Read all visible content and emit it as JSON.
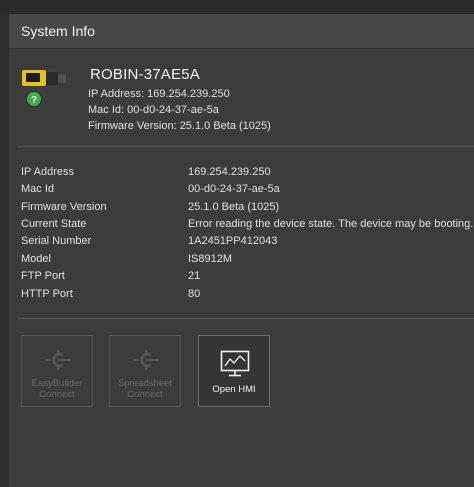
{
  "panel": {
    "title": "System Info"
  },
  "device": {
    "name": "ROBIN-37AE5A",
    "ip_line": "IP Address: 169.254.239.250",
    "mac_line": "Mac Id: 00-d0-24-37-ae-5a",
    "fw_line": "Firmware Version: 25.1.0 Beta (1025)",
    "status_badge": "?"
  },
  "info": {
    "rows": [
      {
        "label": "IP Address",
        "value": "169.254.239.250"
      },
      {
        "label": "Mac Id",
        "value": "00-d0-24-37-ae-5a"
      },
      {
        "label": "Firmware Version",
        "value": "25.1.0 Beta (1025)"
      },
      {
        "label": "Current State",
        "value": "Error reading the device state. The device may be booting."
      },
      {
        "label": "Serial Number",
        "value": "1A2451PP412043"
      },
      {
        "label": "Model",
        "value": "IS8912M"
      },
      {
        "label": "FTP Port",
        "value": "21"
      },
      {
        "label": "HTTP Port",
        "value": "80"
      }
    ]
  },
  "actions": {
    "easybuilder": {
      "line1": "EasyBuilder",
      "line2": "Connect",
      "icon": "connect-plug-icon",
      "enabled": false
    },
    "spreadsheet": {
      "line1": "Spreadsheet",
      "line2": "Connect",
      "icon": "connect-plug-icon",
      "enabled": false
    },
    "hmi": {
      "label": "Open HMI",
      "icon": "monitor-hmi-icon",
      "enabled": true
    }
  },
  "colors": {
    "badge_green": "#3fae49",
    "camera_yellow": "#e8c21a"
  }
}
